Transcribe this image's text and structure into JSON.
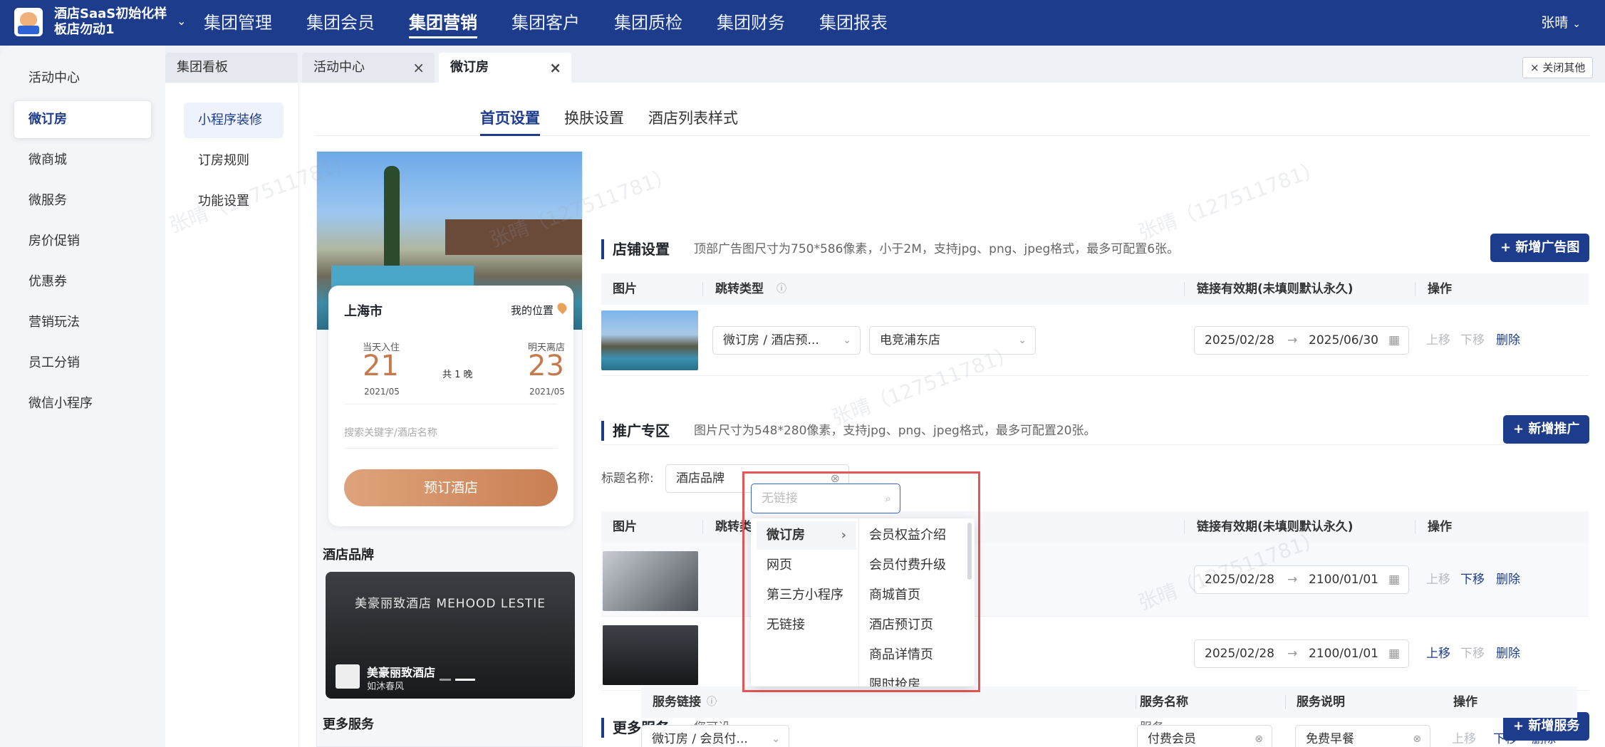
{
  "org": {
    "name": "酒店SaaS初始化样板店勿动1"
  },
  "nav": [
    "集团管理",
    "集团会员",
    "集团营销",
    "集团客户",
    "集团质检",
    "集团财务",
    "集团报表"
  ],
  "user": "张晴",
  "sidebar": [
    "活动中心",
    "微订房",
    "微商城",
    "微服务",
    "房价促销",
    "优惠券",
    "营销玩法",
    "员工分销",
    "微信小程序"
  ],
  "tabs": [
    "集团看板",
    "活动中心",
    "微订房"
  ],
  "close_others": "× 关闭其他",
  "subnav": [
    "小程序装修",
    "订房规则",
    "功能设置"
  ],
  "page_tabs": [
    "首页设置",
    "换肤设置",
    "酒店列表样式"
  ],
  "preview": {
    "city": "上海市",
    "my_location": "我的位置",
    "checkin_label": "当天入住",
    "checkin_day": "21",
    "checkin_month": "2021/05",
    "nights": "共 1 晚",
    "checkout_label": "明天离店",
    "checkout_day": "23",
    "checkout_month": "2021/05",
    "search_placeholder": "搜索关键字/酒店名称",
    "book_button": "预订酒店",
    "brand_section": "酒店品牌",
    "brand_sign": "美豪丽致酒店 MEHOOD LESTIE",
    "brand_name": "美豪丽致酒店",
    "brand_slogan": "如沐春风",
    "more_section": "更多服务"
  },
  "shop": {
    "title": "店铺设置",
    "hint": "顶部广告图尺寸为750*586像素，小于2M，支持jpg、png、jpeg格式，最多可配置6张。",
    "add": "+ 新增广告图",
    "cols": [
      "图片",
      "跳转类型",
      "链接有效期(未填则默认永久)",
      "操作"
    ],
    "row": {
      "jump": "微订房 / 酒店预...",
      "target": "电竞浦东店",
      "start": "2025/02/28",
      "end": "2025/06/30",
      "up": "上移",
      "down": "下移",
      "del": "删除"
    }
  },
  "promo": {
    "title": "推广专区",
    "hint": "图片尺寸为548*280像素，支持jpg、png、jpeg格式，最多可配置20张。",
    "add": "+ 新增推广",
    "name_label": "标题名称:",
    "name_value": "酒店品牌",
    "cols": [
      "图片",
      "跳转类型",
      "链接有效期(未填则默认永久)",
      "操作"
    ],
    "rows": [
      {
        "start": "2025/02/28",
        "end": "2100/01/01",
        "up": "上移",
        "down": "下移",
        "del": "删除"
      },
      {
        "start": "2025/02/28",
        "end": "2100/01/01",
        "up": "上移",
        "down": "下移",
        "del": "删除"
      }
    ]
  },
  "more": {
    "title": "更多服务",
    "hint_a": "您可设",
    "hint_b": "服务。",
    "add": "+ 新增服务",
    "cols": [
      "服务链接",
      "服务名称",
      "服务说明",
      "操作"
    ],
    "row": {
      "link": "微订房 / 会员付...",
      "name": "付费会员",
      "desc": "免费早餐",
      "up": "上移",
      "down": "下移",
      "del": "删除"
    }
  },
  "dropdown": {
    "placeholder": "无链接",
    "col1": [
      "微订房",
      "网页",
      "第三方小程序",
      "无链接"
    ],
    "col2": [
      "会员权益介绍",
      "会员付费升级",
      "商城首页",
      "酒店预订页",
      "商品详情页",
      "限时抢房"
    ]
  },
  "watermark": "张晴（127511781）",
  "colors": {
    "primary": "#1e3c8c",
    "accent_orange": "#d2875a",
    "highlight_border": "#e35757"
  }
}
